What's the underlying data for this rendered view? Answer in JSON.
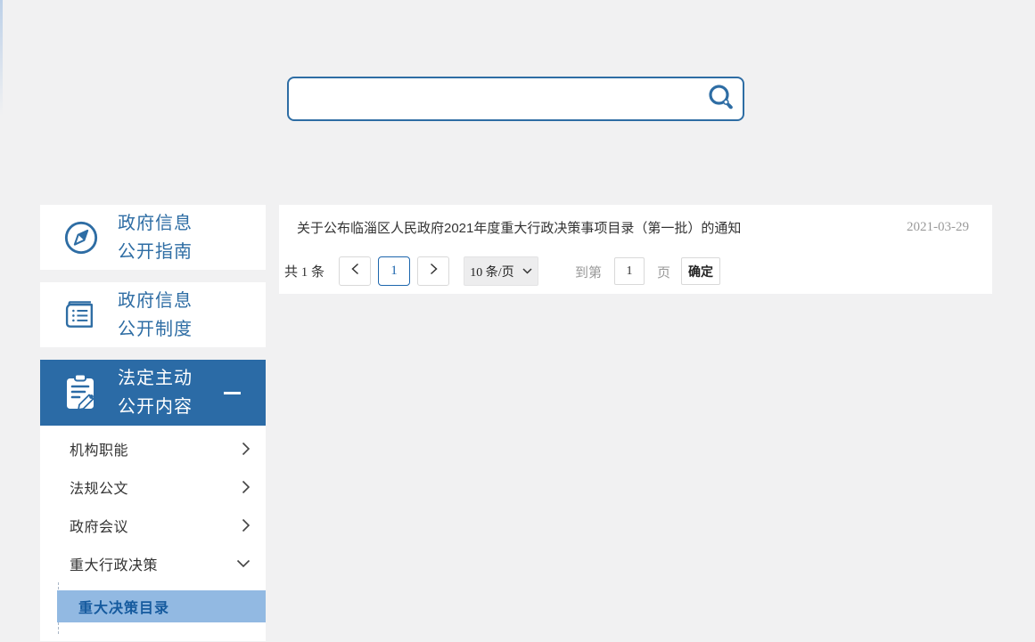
{
  "colors": {
    "primary_blue": "#2e6da4",
    "active_item_bg": "#2b6ba6",
    "highlight_bg": "#92b9e2",
    "highlight_text": "#155a9e",
    "page_bg": "#f1f1f2",
    "muted_gray": "#999999"
  },
  "search": {
    "value": "",
    "icon": "search-key-icon"
  },
  "sidebar": {
    "items": [
      {
        "line1": "政府信息",
        "line2": "公开指南",
        "icon": "compass-icon",
        "active": false
      },
      {
        "line1": "政府信息",
        "line2": "公开制度",
        "icon": "book-icon",
        "active": false
      },
      {
        "line1": "法定主动",
        "line2": "公开内容",
        "icon": "clipboard-pencil-icon",
        "active": true,
        "collapse_icon": "minus-icon"
      }
    ],
    "submenu": {
      "items": [
        {
          "label": "机构职能",
          "icon": "chevron-right-icon"
        },
        {
          "label": "法规公文",
          "icon": "chevron-right-icon"
        },
        {
          "label": "政府会议",
          "icon": "chevron-right-icon"
        },
        {
          "label": "重大行政决策",
          "icon": "chevron-down-icon",
          "expanded": true
        }
      ],
      "active_item": {
        "label": "重大决策目录"
      }
    }
  },
  "content": {
    "list": [
      {
        "title": "关于公布临淄区人民政府2021年度重大行政决策事项目录（第一批）的通知",
        "date": "2021-03-29"
      }
    ],
    "pagination": {
      "total_label": "共 1 条",
      "current_page": "1",
      "page_size_label": "10 条/页",
      "goto_prefix": "到第",
      "goto_value": "1",
      "goto_suffix": "页",
      "confirm_label": "确定"
    }
  }
}
